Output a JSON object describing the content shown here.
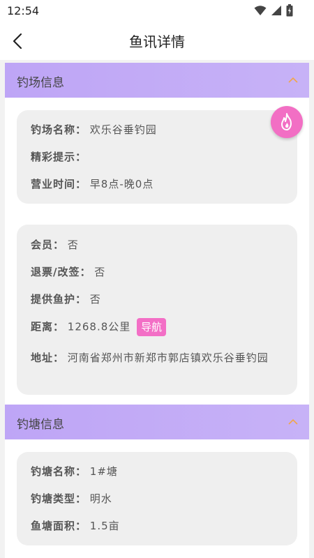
{
  "status": {
    "time": "12:54"
  },
  "header": {
    "title": "鱼讯详情"
  },
  "venue_section": {
    "title": "钓场信息",
    "basic": {
      "name_label": "钓场名称：",
      "name_value": "欢乐谷垂钓园",
      "tip_label": "精彩提示：",
      "tip_value": "",
      "hours_label": "营业时间：",
      "hours_value": "早8点-晚0点"
    },
    "details": {
      "member_label": "会员：",
      "member_value": "否",
      "refund_label": "退票/改签：",
      "refund_value": "否",
      "fishguard_label": "提供鱼护：",
      "fishguard_value": "否",
      "distance_label": "距离：",
      "distance_value": "1268.8公里",
      "nav_label": "导航",
      "address_label": "地址：",
      "address_value": "河南省郑州市新郑市郭店镇欢乐谷垂钓园"
    }
  },
  "pond_section": {
    "title": "钓塘信息",
    "pond_name_label": "钓塘名称：",
    "pond_name_value": "1#塘",
    "pond_type_label": "钓塘类型：",
    "pond_type_value": "明水",
    "pond_area_label": "鱼塘面积：",
    "pond_area_value": "1.5亩"
  },
  "colors": {
    "section_header": "#c1a8f6",
    "accent_pink": "#f26fc4",
    "card_bg": "#efefef"
  },
  "icons": [
    "wifi-icon",
    "signal-icon",
    "battery-icon",
    "back-arrow-icon",
    "chevron-up-icon",
    "fire-icon"
  ]
}
